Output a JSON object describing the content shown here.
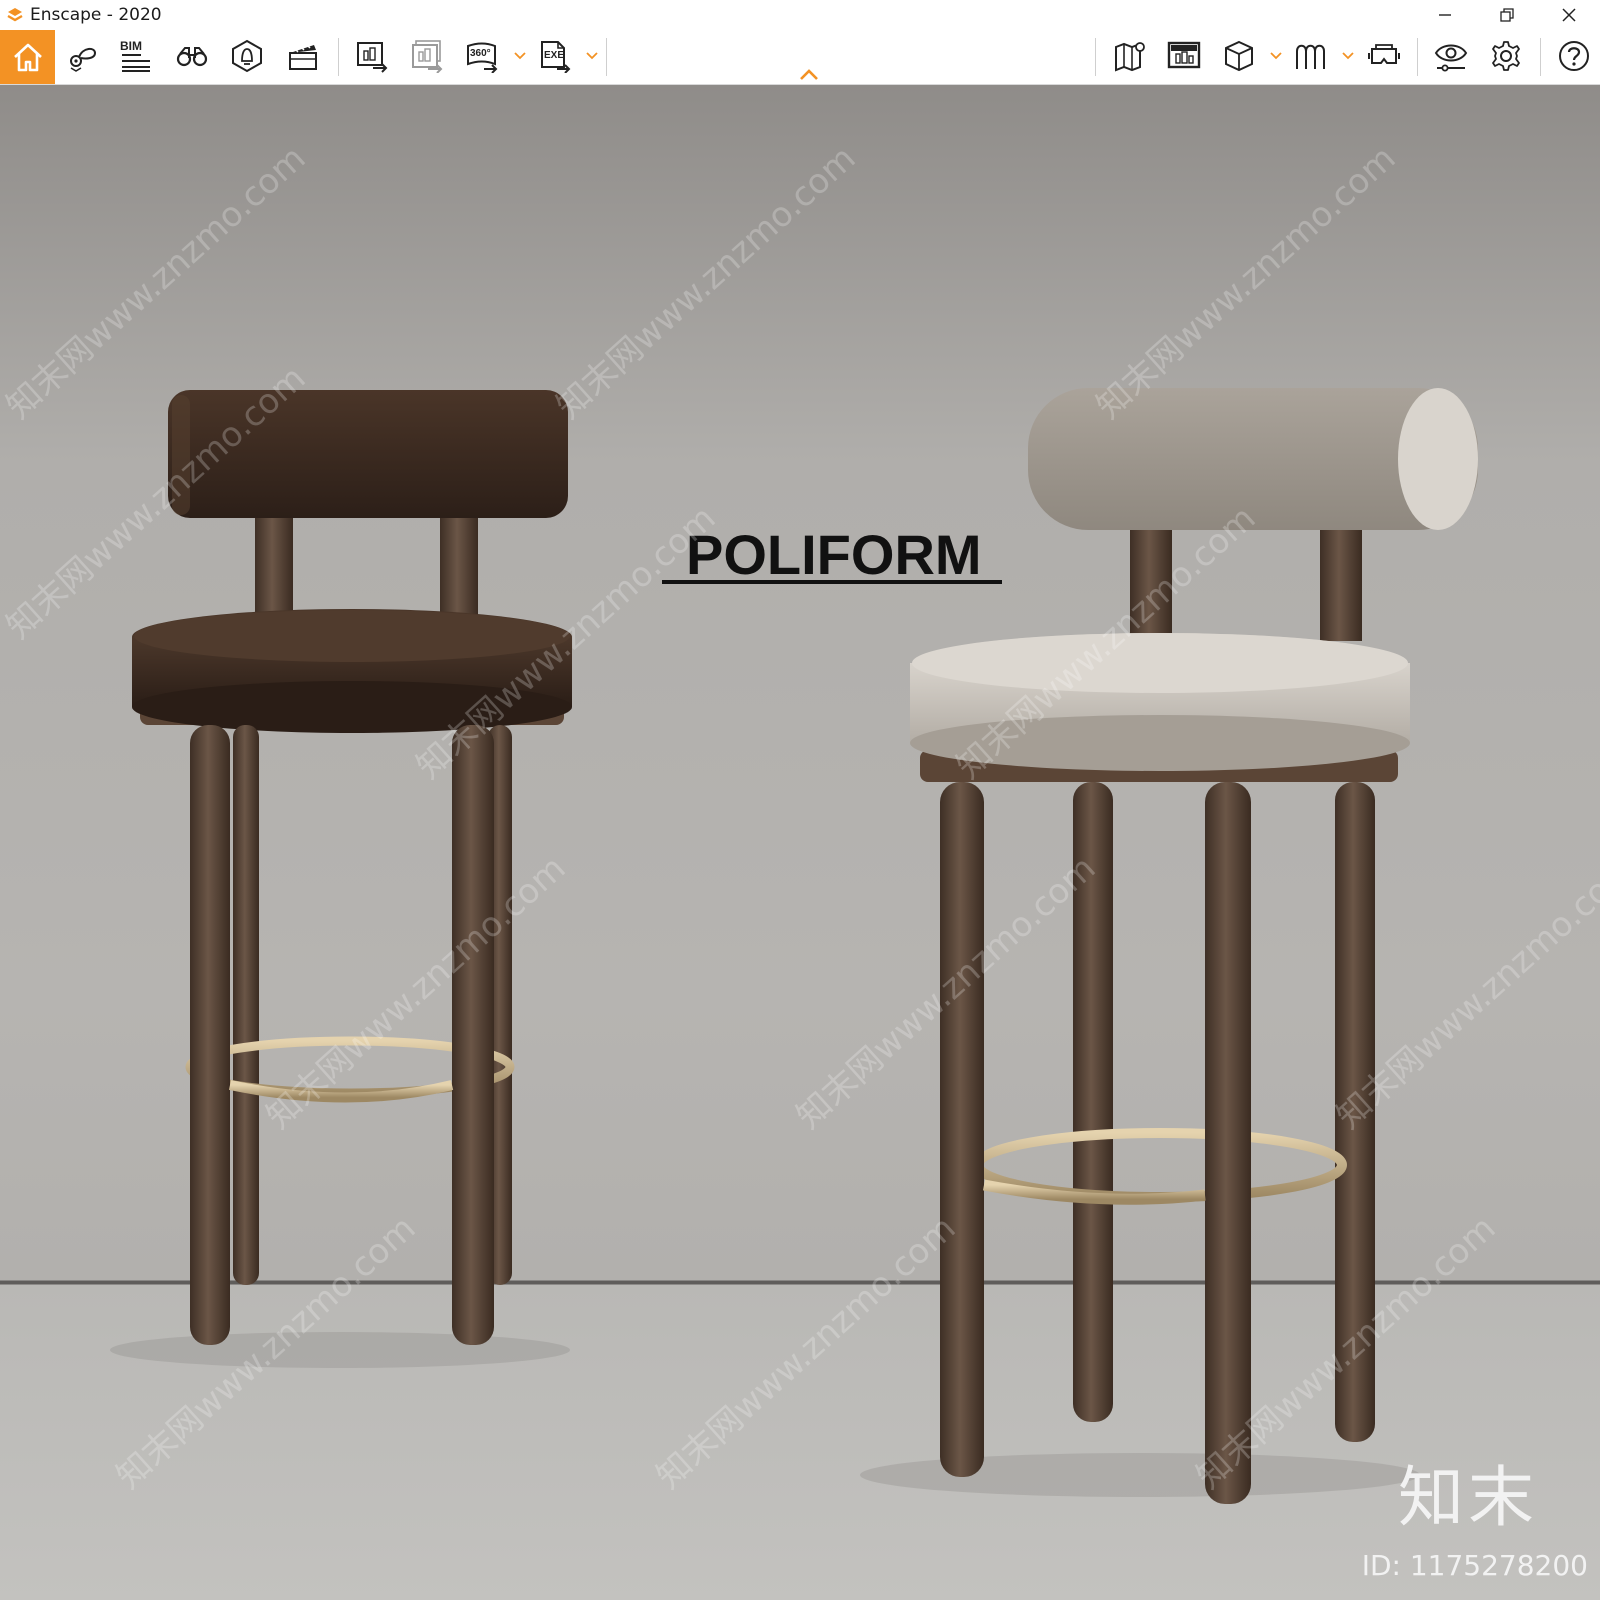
{
  "window": {
    "title": "Enscape - 2020"
  },
  "toolbar": {
    "bim_label": "BIM",
    "panorama_label": "360°",
    "exe_label": "EXE",
    "accent_color": "#f39224"
  },
  "scene": {
    "brand_text": "POLIFORM",
    "watermark_text": "知末网www.znzmo.com",
    "corner_logo": "知末",
    "corner_id": "ID: 1175278200"
  },
  "icons": [
    "enscape-logo-icon",
    "home-icon",
    "location-tag-icon",
    "bim-icon",
    "binoculars-icon",
    "light-bulb-icon",
    "clapperboard-icon",
    "export-screenshot-icon",
    "batch-render-icon",
    "panorama-360-icon",
    "export-exe-icon",
    "map-icon",
    "asset-library-icon",
    "cube-icon",
    "atmosphere-icon",
    "vr-headset-icon",
    "visual-settings-icon",
    "settings-gear-icon",
    "help-icon",
    "minimize-icon",
    "restore-icon",
    "close-icon"
  ]
}
